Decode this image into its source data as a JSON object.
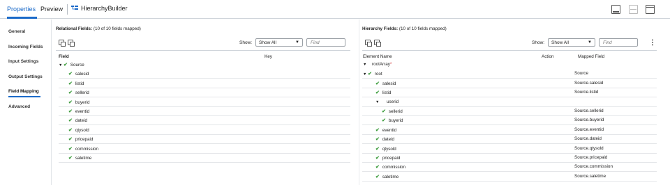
{
  "tabs": [
    {
      "label": "Properties",
      "active": true
    },
    {
      "label": "Preview",
      "active": false
    }
  ],
  "breadcrumb": {
    "label": "HierarchyBuilder",
    "icon": "hierarchy-builder-icon"
  },
  "window_controls": [
    "panel-bottom-icon",
    "panel-split-icon",
    "panel-maximize-icon"
  ],
  "sidebar": {
    "items": [
      {
        "label": "General"
      },
      {
        "label": "Incoming Fields"
      },
      {
        "label": "Input Settings"
      },
      {
        "label": "Output Settings"
      },
      {
        "label": "Field Mapping",
        "active": true
      },
      {
        "label": "Advanced"
      }
    ]
  },
  "relational": {
    "title": "Relational Fields:",
    "summary": "(10 of 10 fields mapped)",
    "show_label": "Show:",
    "show_value": "Show All",
    "find_placeholder": "Find",
    "columns": [
      "Field",
      "Key"
    ],
    "rows": [
      {
        "name": "Source",
        "expanded": true,
        "depth": 0
      },
      {
        "name": "salesid",
        "depth": 1
      },
      {
        "name": "listid",
        "depth": 1
      },
      {
        "name": "sellerid",
        "depth": 1
      },
      {
        "name": "buyerid",
        "depth": 1
      },
      {
        "name": "eventid",
        "depth": 1
      },
      {
        "name": "dateid",
        "depth": 1
      },
      {
        "name": "qtysold",
        "depth": 1
      },
      {
        "name": "pricepaid",
        "depth": 1
      },
      {
        "name": "commission",
        "depth": 1
      },
      {
        "name": "saletime",
        "depth": 1
      }
    ]
  },
  "hierarchy": {
    "title": "Hierarchy Fields:",
    "summary": "(10 of 10 fields mapped)",
    "show_label": "Show:",
    "show_value": "Show All",
    "find_placeholder": "Find",
    "columns": [
      "Element Name",
      "Action",
      "Mapped Field"
    ],
    "rows": [
      {
        "name": "rootArray",
        "required": "*",
        "mapped": "",
        "check": false,
        "expanded": true,
        "depth": 0
      },
      {
        "name": "root",
        "mapped": "Source",
        "check": true,
        "expanded": true,
        "depth": 1
      },
      {
        "name": "salesid",
        "mapped": "Source.salesid",
        "check": true,
        "depth": 2
      },
      {
        "name": "listid",
        "mapped": "Source.listid",
        "check": true,
        "depth": 2
      },
      {
        "name": "userid",
        "mapped": "",
        "check": false,
        "expanded": true,
        "depth": 2
      },
      {
        "name": "sellerid",
        "mapped": "Source.sellerid",
        "check": true,
        "depth": 3
      },
      {
        "name": "buyerid",
        "mapped": "Source.buyerid",
        "check": true,
        "depth": 3
      },
      {
        "name": "eventid",
        "mapped": "Source.eventid",
        "check": true,
        "depth": 2
      },
      {
        "name": "dateid",
        "mapped": "Source.dateid",
        "check": true,
        "depth": 2
      },
      {
        "name": "qtysold",
        "mapped": "Source.qtysold",
        "check": true,
        "depth": 2
      },
      {
        "name": "pricepaid",
        "mapped": "Source.pricepaid",
        "check": true,
        "depth": 2
      },
      {
        "name": "commission",
        "mapped": "Source.commission",
        "check": true,
        "depth": 2
      },
      {
        "name": "saletime",
        "mapped": "Source.saletime",
        "check": true,
        "depth": 2
      }
    ]
  }
}
